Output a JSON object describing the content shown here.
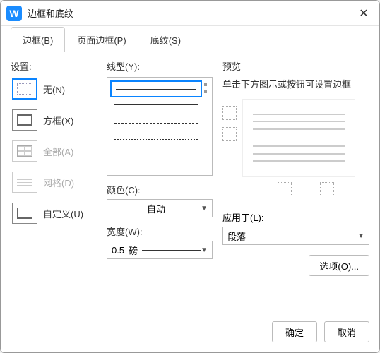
{
  "title": "边框和底纹",
  "app_icon_letter": "W",
  "tabs": [
    {
      "label": "边框(B)",
      "active": true
    },
    {
      "label": "页面边框(P)",
      "active": false
    },
    {
      "label": "底纹(S)",
      "active": false
    }
  ],
  "settings": {
    "label": "设置:",
    "items": [
      {
        "key": "none",
        "label": "无(N)",
        "disabled": false,
        "selected": true
      },
      {
        "key": "box",
        "label": "方框(X)",
        "disabled": false,
        "selected": false
      },
      {
        "key": "all",
        "label": "全部(A)",
        "disabled": true,
        "selected": false
      },
      {
        "key": "grid",
        "label": "网格(D)",
        "disabled": true,
        "selected": false
      },
      {
        "key": "custom",
        "label": "自定义(U)",
        "disabled": false,
        "selected": false
      }
    ]
  },
  "line": {
    "type_label": "线型(Y):",
    "color_label": "颜色(C):",
    "color_value": "自动",
    "width_label": "宽度(W):",
    "width_value": "0.5",
    "width_unit": "磅"
  },
  "preview": {
    "label": "预览",
    "hint": "单击下方图示或按钮可设置边框",
    "apply_label": "应用于(L):",
    "apply_value": "段落",
    "options_label": "选项(O)..."
  },
  "footer": {
    "ok": "确定",
    "cancel": "取消"
  }
}
